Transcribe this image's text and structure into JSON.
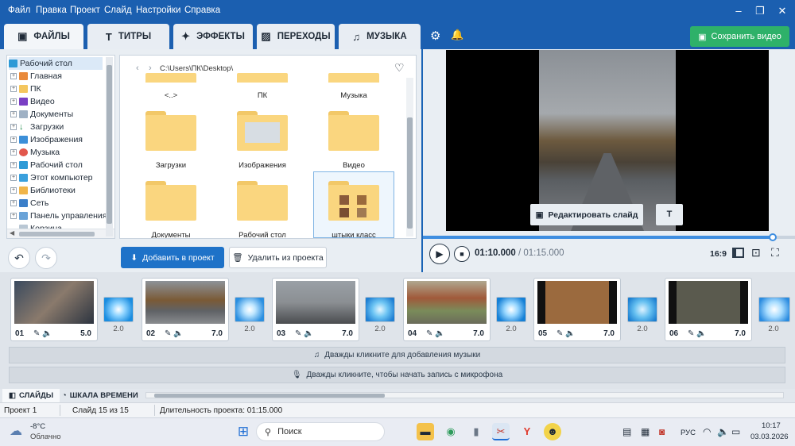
{
  "menu": [
    "Файл",
    "Правка",
    "Проект",
    "Слайд",
    "Настройки",
    "Справка"
  ],
  "tabs": [
    {
      "label": "ФАЙЛЫ",
      "icon": "add-media-icon"
    },
    {
      "label": "ТИТРЫ",
      "icon": "text-icon"
    },
    {
      "label": "ЭФФЕКТЫ",
      "icon": "effects-star-icon"
    },
    {
      "label": "ПЕРЕХОДЫ",
      "icon": "transitions-icon"
    },
    {
      "label": "МУЗЫКА",
      "icon": "music-note-icon"
    }
  ],
  "save_label": "Сохранить видео",
  "tree": [
    "Рабочий стол",
    "Главная",
    "ПК",
    "Видео",
    "Документы",
    "Загрузки",
    "Изображения",
    "Музыка",
    "Рабочий стол",
    "Этот компьютер",
    "Библиотеки",
    "Сеть",
    "Панель управления",
    "Корзина"
  ],
  "browser": {
    "path": "C:\\Users\\ПК\\Desktop\\",
    "top_row": [
      "<..>",
      "ПК",
      "Музыка"
    ],
    "folders": [
      "Загрузки",
      "Изображения",
      "Видео",
      "Документы",
      "Рабочий стол",
      "штыки класс"
    ]
  },
  "add_label": "Добавить в проект",
  "remove_label": "Удалить из проекта",
  "preview": {
    "edit_slide": "Редактировать слайд",
    "text_btn": "T",
    "time_current": "01:10.000",
    "time_sep": " / ",
    "time_total": "01:15.000",
    "aspect": "16:9",
    "progress": 0.94
  },
  "slides": [
    {
      "num": "01",
      "dur": "5.0",
      "trans": "2.0"
    },
    {
      "num": "02",
      "dur": "7.0",
      "trans": "2.0"
    },
    {
      "num": "03",
      "dur": "7.0",
      "trans": "2.0"
    },
    {
      "num": "04",
      "dur": "7.0",
      "trans": "2.0"
    },
    {
      "num": "05",
      "dur": "7.0",
      "trans": "2.0"
    },
    {
      "num": "06",
      "dur": "7.0",
      "trans": "2.0"
    }
  ],
  "music_track": "Дважды кликните для добавления музыки",
  "mic_track": "Дважды кликните, чтобы начать запись с микрофона",
  "bottom_tabs": [
    "СЛАЙДЫ",
    "ШКАЛА ВРЕМЕНИ"
  ],
  "status": {
    "project": "Проект 1",
    "slide": "Слайд 15 из 15",
    "duration": "Длительность проекта: 01:15.000"
  },
  "taskbar": {
    "temp": "-8°C",
    "weather": "Облачно",
    "search": "Поиск",
    "lang": "РУС",
    "time": "10:17",
    "date": "03.03.2026"
  },
  "colors": {
    "brand": "#1b5fb0",
    "save": "#2eb169",
    "accent": "#1e72c8"
  }
}
